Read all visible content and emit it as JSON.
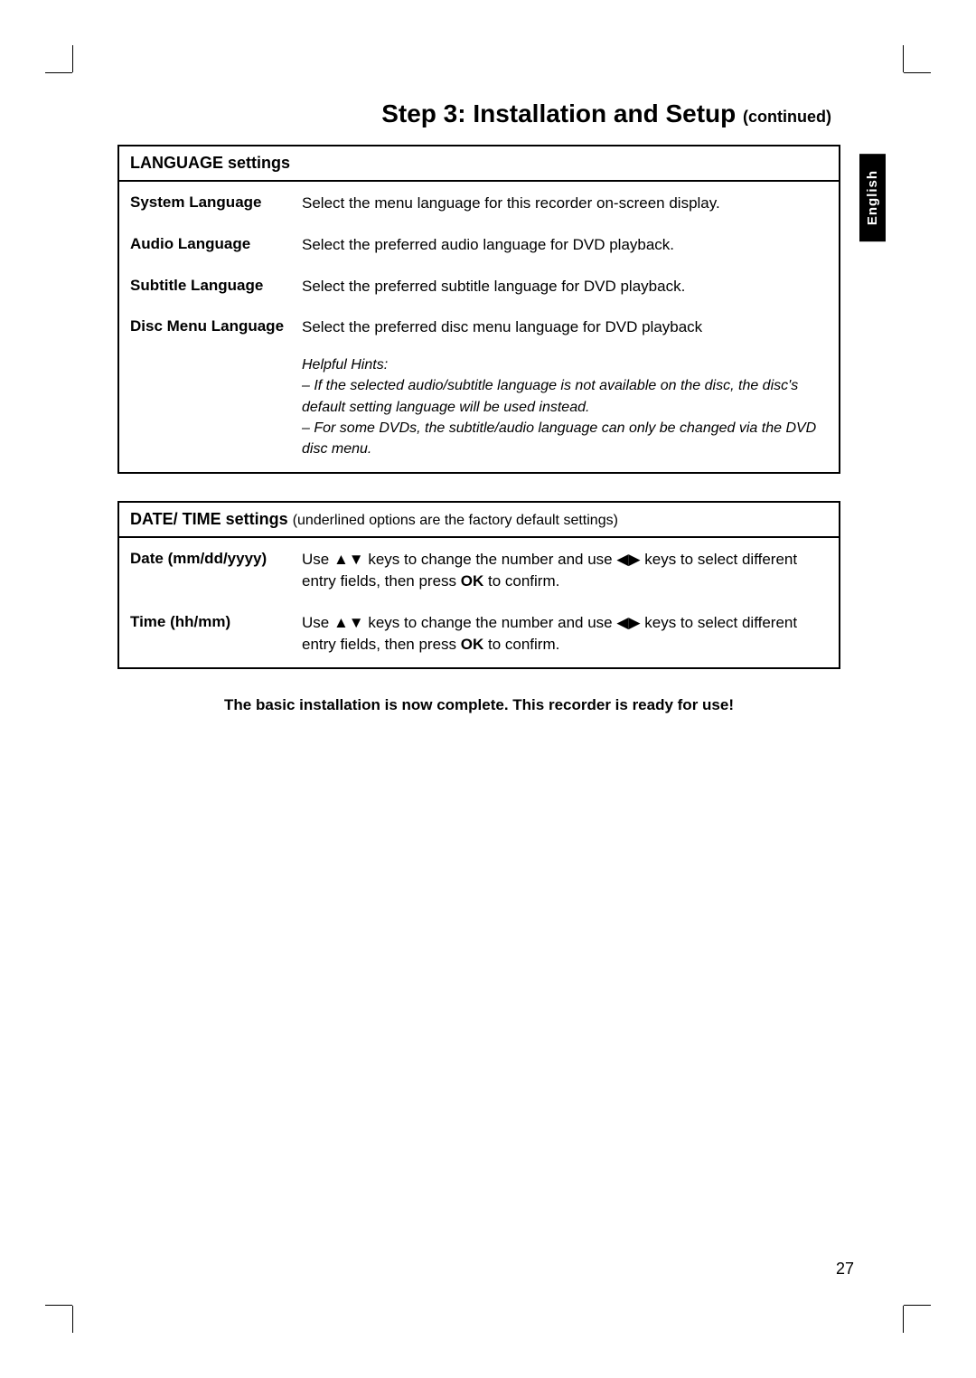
{
  "title_main": "Step 3: Installation and Setup",
  "title_cont": "(continued)",
  "language_tab": "English",
  "page_number": "27",
  "box1": {
    "header_bold": "LANGUAGE settings",
    "rows": [
      {
        "label": "System Language",
        "desc": "Select the menu language for this recorder on-screen display."
      },
      {
        "label": "Audio Language",
        "desc": "Select the preferred audio language for DVD playback."
      },
      {
        "label": "Subtitle Language",
        "desc": "Select the preferred subtitle language for DVD playback."
      },
      {
        "label": "Disc Menu Language",
        "desc": "Select the preferred disc menu language for DVD playback"
      }
    ],
    "hints_title": "Helpful Hints:",
    "hints_1": "–  If the selected audio/subtitle language is not available on the disc, the disc's default setting language will be used instead.",
    "hints_2": "–  For some DVDs, the subtitle/audio language can only be changed via the DVD disc menu."
  },
  "box2": {
    "header_bold": "DATE/ TIME settings",
    "header_note": "(underlined options are the factory default settings)",
    "rows": [
      {
        "label": "Date (mm/dd/yyyy)",
        "desc_pre": "Use ",
        "desc_mid1": " keys to change the number and use ",
        "desc_mid2": " keys to select different entry fields, then press ",
        "ok": "OK",
        "desc_post": " to confirm."
      },
      {
        "label": "Time (hh/mm)",
        "desc_pre": "Use ",
        "desc_mid1": " keys to change the number and use ",
        "desc_mid2": " keys to select different entry fields, then press ",
        "ok": "OK",
        "desc_post": " to confirm."
      }
    ]
  },
  "completion": "The basic installation is now complete. This recorder is ready for use!",
  "icons": {
    "up_down": "▲▼",
    "left_right": "◀▶"
  }
}
